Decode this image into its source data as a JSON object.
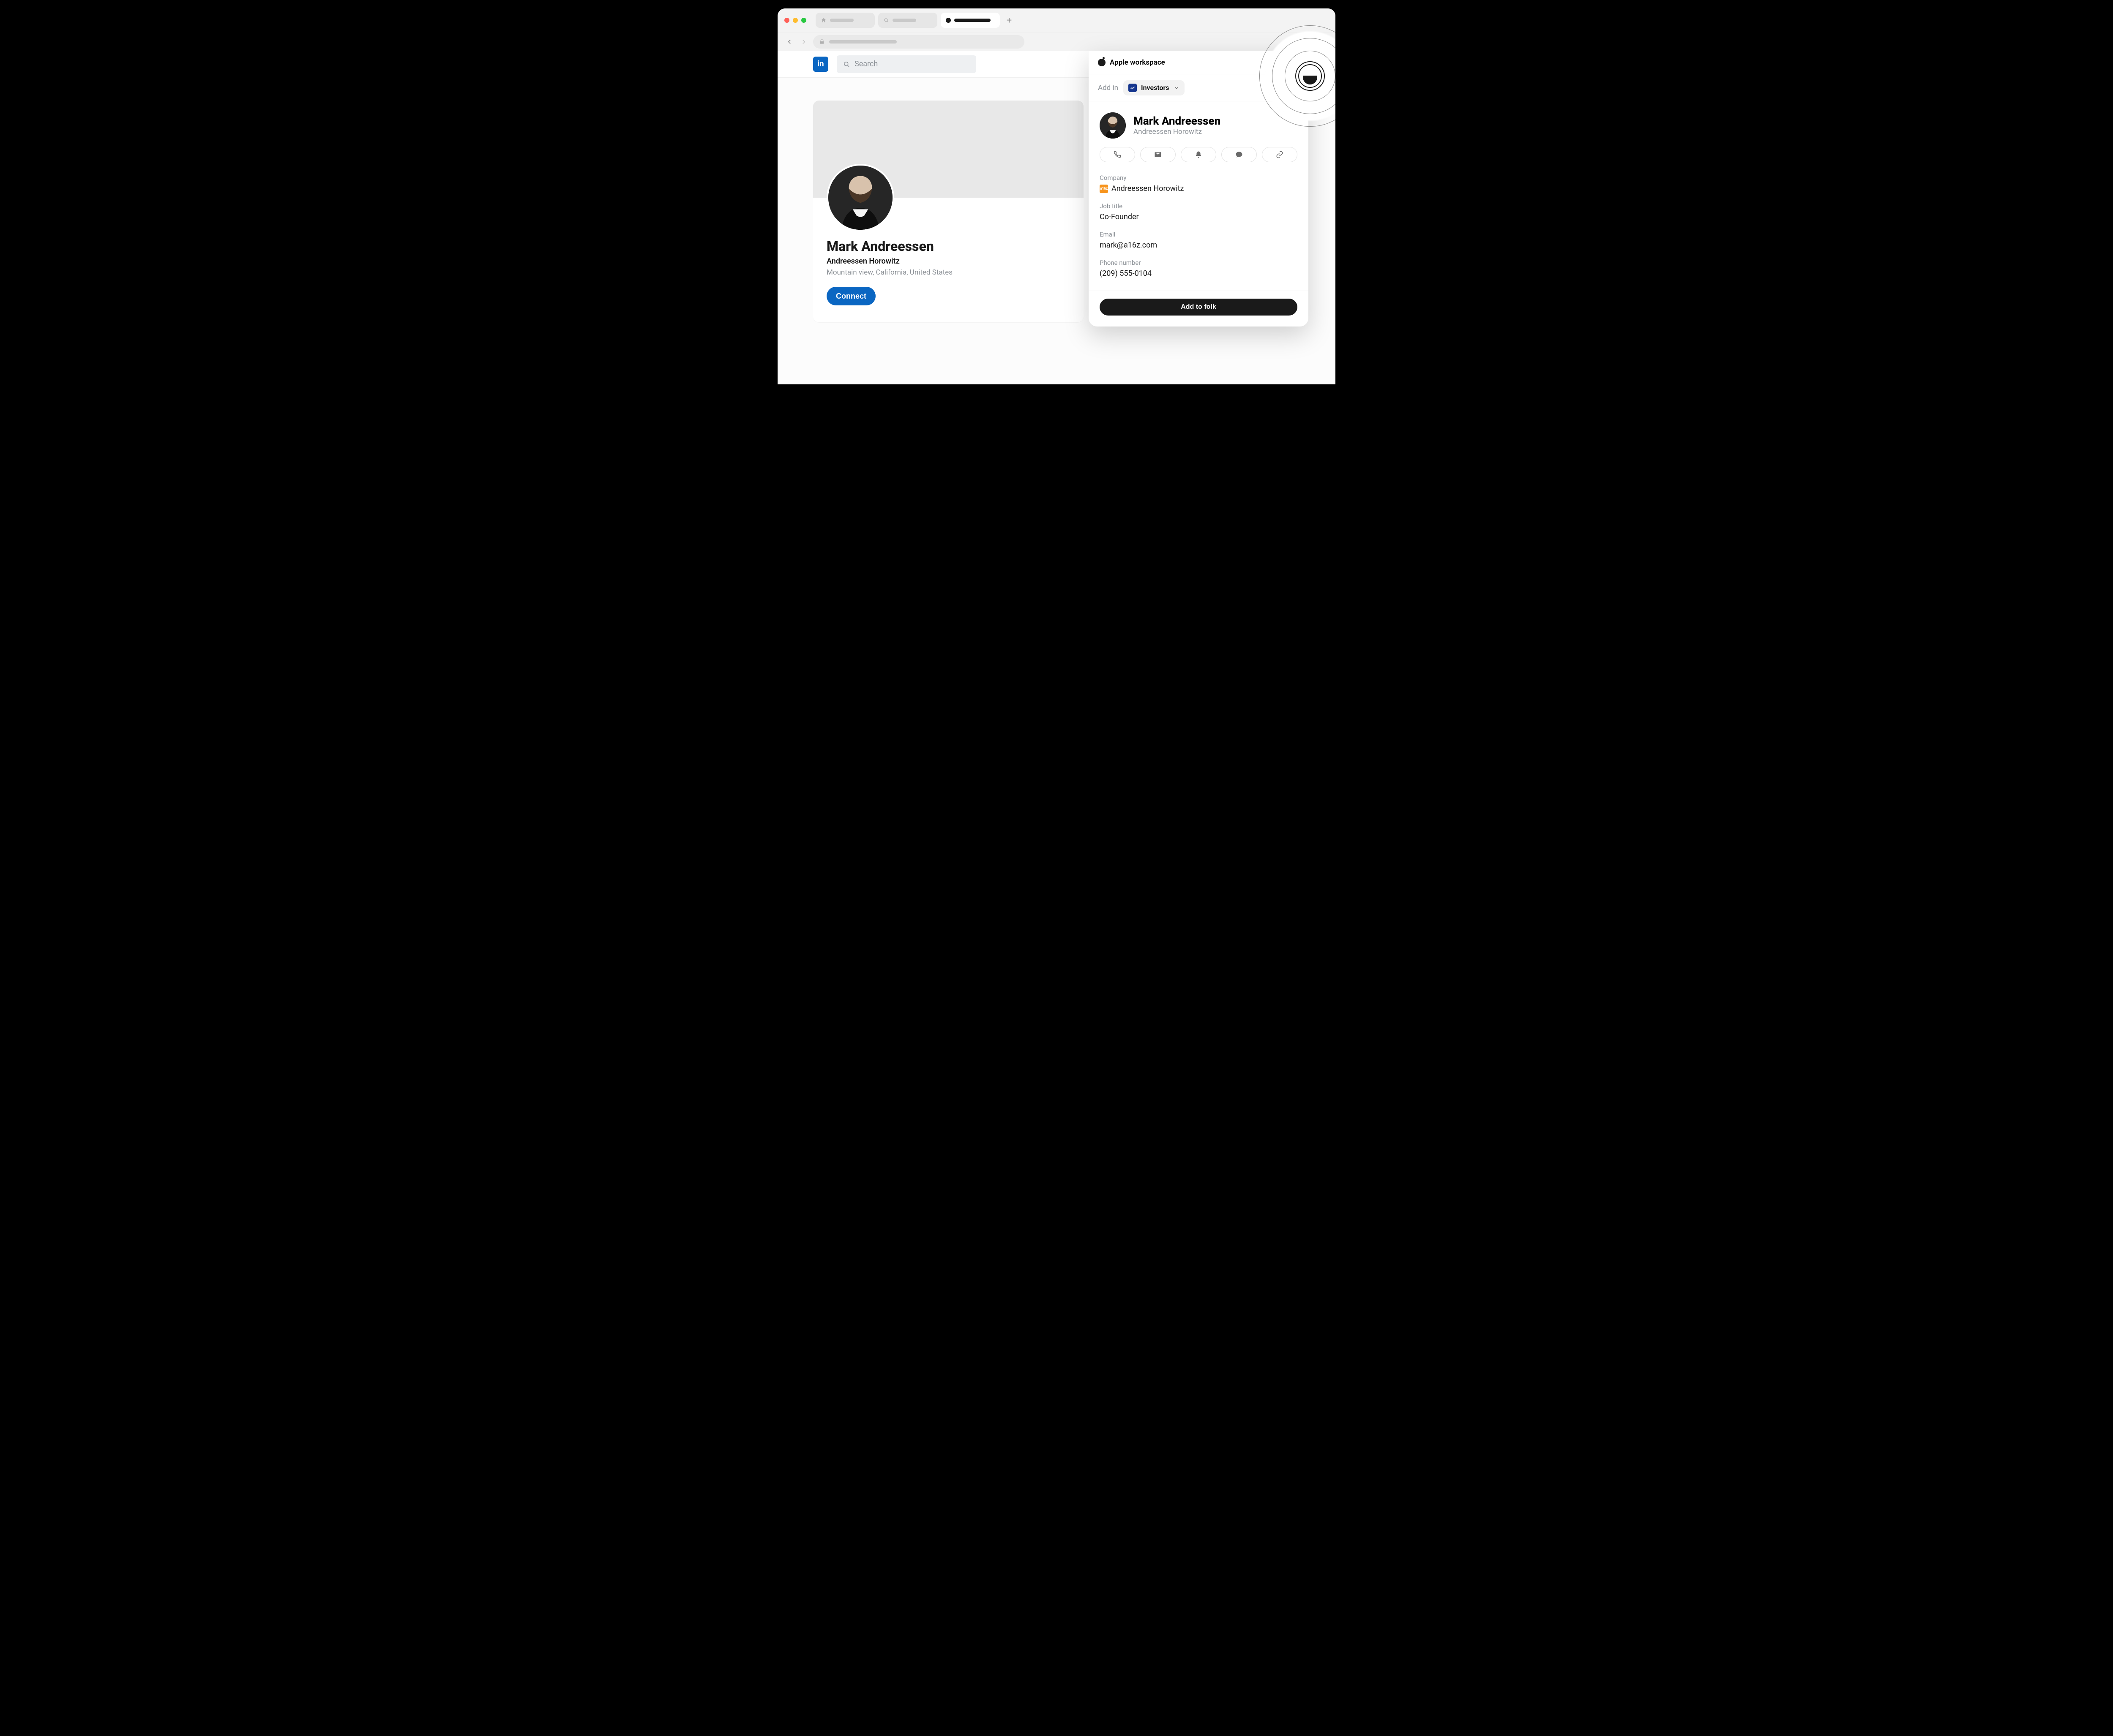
{
  "browser": {
    "traffic_colors": [
      "#ff5f57",
      "#febc2e",
      "#28c840"
    ]
  },
  "site": {
    "logo_text": "in",
    "search_placeholder": "Search"
  },
  "profile": {
    "name": "Mark Andreessen",
    "org": "Andreessen Horowitz",
    "location": "Mountain view, California, United States",
    "connect_label": "Connect"
  },
  "ext": {
    "workspace_icon": "apple",
    "workspace_name": "Apple workspace",
    "addin_label": "Add in",
    "addin_chip": {
      "icon": "chart",
      "label": "Investors"
    },
    "person": {
      "name": "Mark Andreessen",
      "org": "Andreessen Horowitz"
    },
    "actions": [
      "phone",
      "email",
      "bell",
      "chat",
      "link"
    ],
    "fields": {
      "company_label": "Company",
      "company_value": "Andreessen Horowitz",
      "company_badge": "a16z",
      "job_label": "Job title",
      "job_value": "Co-Founder",
      "email_label": "Email",
      "email_value": "mark@a16z.com",
      "phone_label": "Phone number",
      "phone_value": "(209) 555-0104"
    },
    "add_button": "Add to folk"
  }
}
